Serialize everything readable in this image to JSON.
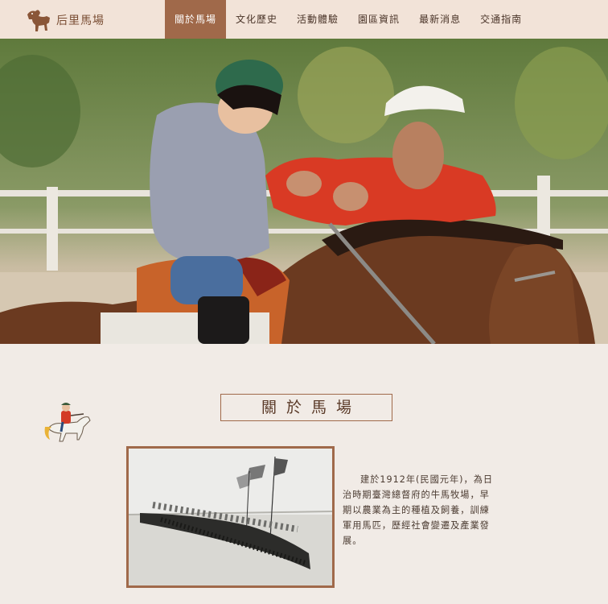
{
  "brand": {
    "name": "后里馬場",
    "logo_icon": "horse-logo-icon"
  },
  "nav": {
    "items": [
      {
        "label": "關於馬場",
        "active": true
      },
      {
        "label": "文化歷史",
        "active": false
      },
      {
        "label": "活動體驗",
        "active": false
      },
      {
        "label": "園區資訊",
        "active": false
      },
      {
        "label": "最新消息",
        "active": false
      },
      {
        "label": "交通指南",
        "active": false
      }
    ]
  },
  "about": {
    "title": "關於馬場",
    "intro": "建於1912年(民國元年)，為日治時期臺灣總督府的牛馬牧場，早期以農業為主的種植及飼養，訓練軍用馬匹，歷經社會變遷及產業發展。"
  },
  "colors": {
    "header_bg": "#f2e3d8",
    "accent": "#a0694a",
    "page_bg": "#f1ebe6"
  }
}
